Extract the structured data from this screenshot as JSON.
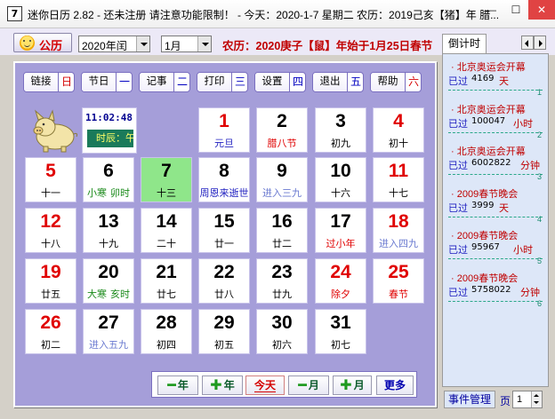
{
  "app": {
    "icon_text": "7",
    "title": "迷你日历 2.82 - 还未注册 请注意功能限制！ - 今天：2020-1-7 星期二 农历：2019己亥【猪】年 腊..."
  },
  "window_controls": {
    "minimize": "—",
    "maximize": "☐",
    "close": "✕"
  },
  "toolbar": {
    "solar_label": "公历",
    "year_value": "2020年闰",
    "month_value": "1月",
    "lunar_info": "农历：2020庚子【鼠】年始于1月25日春节"
  },
  "function_buttons": [
    {
      "label": "链接",
      "index": "日",
      "index_color": "#d40000"
    },
    {
      "label": "节日",
      "index": "一",
      "index_color": "#0000c0"
    },
    {
      "label": "记事",
      "index": "二",
      "index_color": "#0000c0"
    },
    {
      "label": "打印",
      "index": "三",
      "index_color": "#0000c0"
    },
    {
      "label": "设置",
      "index": "四",
      "index_color": "#0000c0"
    },
    {
      "label": "退出",
      "index": "五",
      "index_color": "#0000c0"
    },
    {
      "label": "帮助",
      "index": "六",
      "index_color": "#d40000"
    }
  ],
  "clock": {
    "time": "11:02:48",
    "shichen": "时辰：午"
  },
  "calendar": {
    "days": [
      {
        "day": "1",
        "day_color": "red",
        "sub": "元旦",
        "sub_color": "blue"
      },
      {
        "day": "2",
        "day_color": "blk",
        "sub": "腊八节",
        "sub_color": "red"
      },
      {
        "day": "3",
        "day_color": "blk",
        "sub": "初九",
        "sub_color": "blk"
      },
      {
        "day": "4",
        "day_color": "red",
        "sub": "初十",
        "sub_color": "blk"
      },
      {
        "day": "5",
        "day_color": "red",
        "sub": "十一",
        "sub_color": "blk"
      },
      {
        "day": "6",
        "day_color": "blk",
        "sub_left": "小寒",
        "sub_right": "卯时"
      },
      {
        "day": "7",
        "day_color": "blk",
        "sub": "十三",
        "sub_color": "blk",
        "today": true
      },
      {
        "day": "8",
        "day_color": "blk",
        "sub": "周恩来逝世",
        "sub_color": "blue"
      },
      {
        "day": "9",
        "day_color": "blk",
        "sub": "进入三九",
        "sub_color": "lblue"
      },
      {
        "day": "10",
        "day_color": "blk",
        "sub": "十六",
        "sub_color": "blk"
      },
      {
        "day": "11",
        "day_color": "red",
        "sub": "十七",
        "sub_color": "blk"
      },
      {
        "day": "12",
        "day_color": "red",
        "sub": "十八",
        "sub_color": "blk"
      },
      {
        "day": "13",
        "day_color": "blk",
        "sub": "十九",
        "sub_color": "blk"
      },
      {
        "day": "14",
        "day_color": "blk",
        "sub": "二十",
        "sub_color": "blk"
      },
      {
        "day": "15",
        "day_color": "blk",
        "sub": "廿一",
        "sub_color": "blk"
      },
      {
        "day": "16",
        "day_color": "blk",
        "sub": "廿二",
        "sub_color": "blk"
      },
      {
        "day": "17",
        "day_color": "blk",
        "sub": "过小年",
        "sub_color": "red"
      },
      {
        "day": "18",
        "day_color": "red",
        "sub": "进入四九",
        "sub_color": "lblue"
      },
      {
        "day": "19",
        "day_color": "red",
        "sub": "廿五",
        "sub_color": "blk"
      },
      {
        "day": "20",
        "day_color": "blk",
        "sub_left": "大寒",
        "sub_right": "亥时"
      },
      {
        "day": "21",
        "day_color": "blk",
        "sub": "廿七",
        "sub_color": "blk"
      },
      {
        "day": "22",
        "day_color": "blk",
        "sub": "廿八",
        "sub_color": "blk"
      },
      {
        "day": "23",
        "day_color": "blk",
        "sub": "廿九",
        "sub_color": "blk"
      },
      {
        "day": "24",
        "day_color": "red",
        "sub": "除夕",
        "sub_color": "red"
      },
      {
        "day": "25",
        "day_color": "red",
        "sub": "春节",
        "sub_color": "red"
      },
      {
        "day": "26",
        "day_color": "red",
        "sub": "初二",
        "sub_color": "blk"
      },
      {
        "day": "27",
        "day_color": "blk",
        "sub": "进入五九",
        "sub_color": "lblue"
      },
      {
        "day": "28",
        "day_color": "blk",
        "sub": "初四",
        "sub_color": "blk"
      },
      {
        "day": "29",
        "day_color": "blk",
        "sub": "初五",
        "sub_color": "blk"
      },
      {
        "day": "30",
        "day_color": "blk",
        "sub": "初六",
        "sub_color": "blk"
      },
      {
        "day": "31",
        "day_color": "blk",
        "sub": "初七",
        "sub_color": "blk"
      }
    ]
  },
  "bottom_nav": {
    "prev_year": "年",
    "next_year": "年",
    "today": "今天",
    "prev_month": "月",
    "next_month": "月",
    "more": "更多"
  },
  "sidebar": {
    "tab_label": "倒计时",
    "events": [
      {
        "title": "北京奥运会开幕",
        "passed": "已过",
        "value": "4169",
        "unit": "天",
        "index": "1"
      },
      {
        "title": "北京奥运会开幕",
        "passed": "已过",
        "value": "100047",
        "unit": "小时",
        "index": "2"
      },
      {
        "title": "北京奥运会开幕",
        "passed": "已过",
        "value": "6002822",
        "unit": "分钟",
        "index": "3"
      },
      {
        "title": "2009春节晚会",
        "passed": "已过",
        "value": "3999",
        "unit": "天",
        "index": "4"
      },
      {
        "title": "2009春节晚会",
        "passed": "已过",
        "value": "95967",
        "unit": "小时",
        "index": "5"
      },
      {
        "title": "2009春节晚会",
        "passed": "已过",
        "value": "5758022",
        "unit": "分钟",
        "index": "6"
      }
    ],
    "event_manager_label": "事件管理",
    "page_label": "页",
    "page_value": "1"
  }
}
